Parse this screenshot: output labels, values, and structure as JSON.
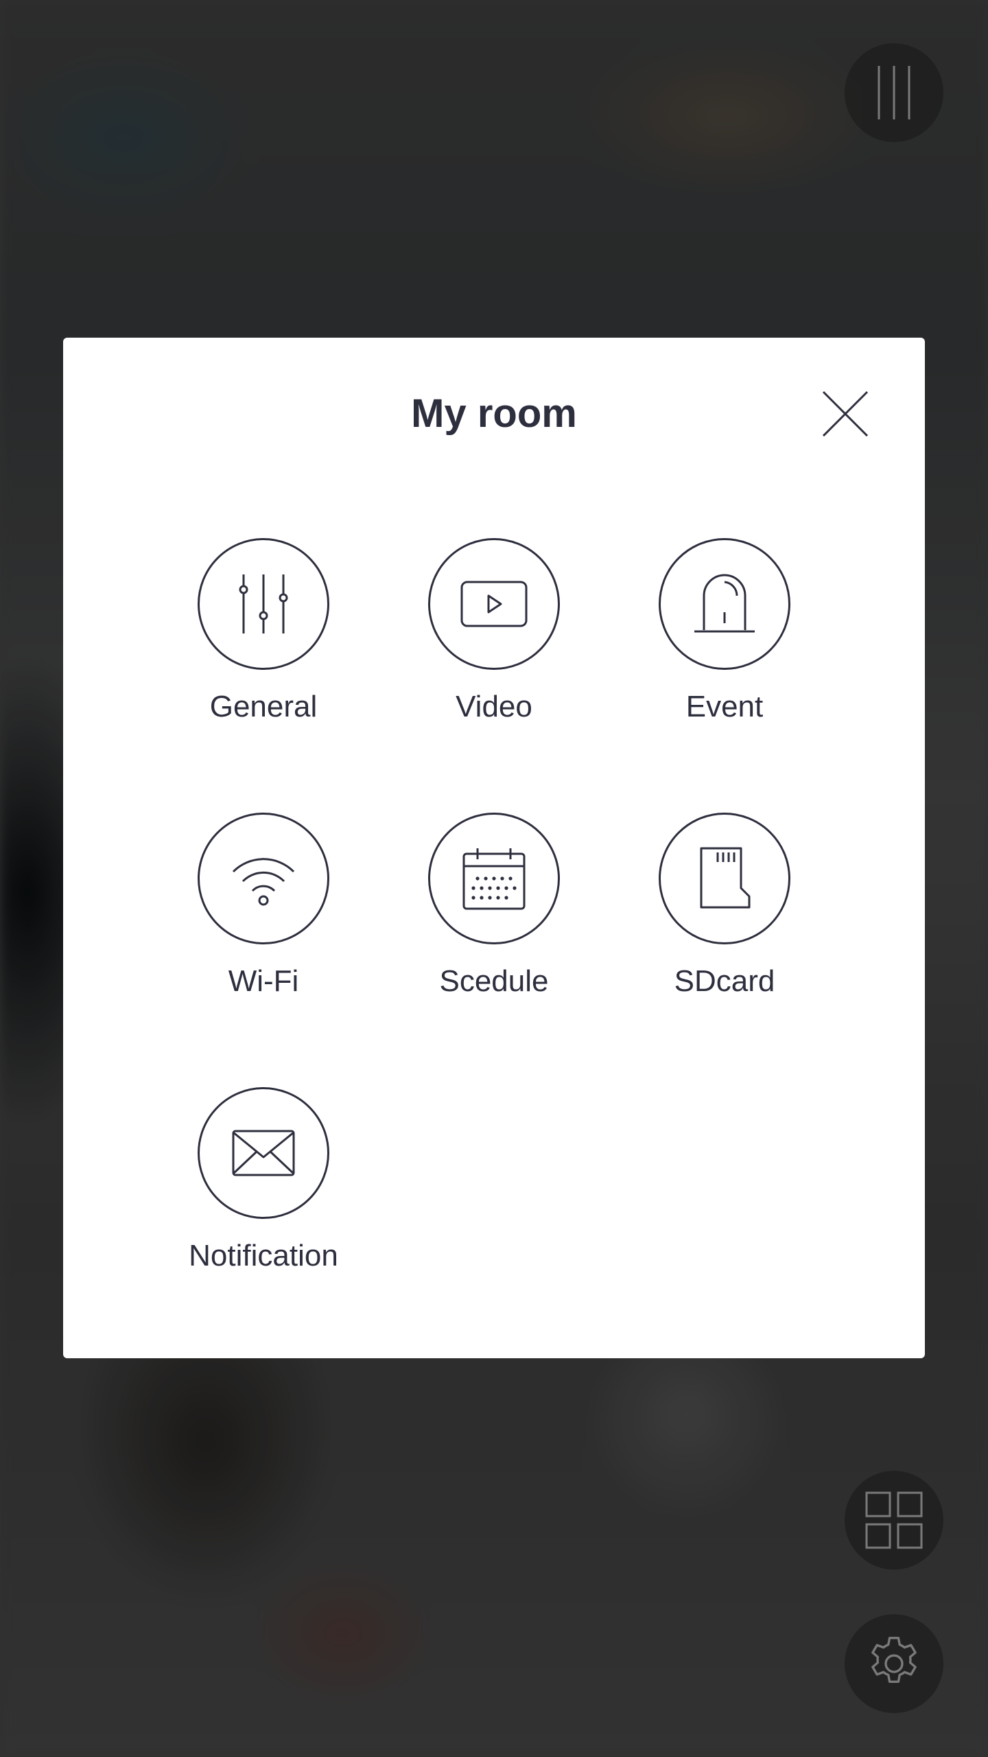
{
  "modal": {
    "title": "My room"
  },
  "menu": [
    {
      "label": "General",
      "icon": "sliders-icon"
    },
    {
      "label": "Video",
      "icon": "video-play-icon"
    },
    {
      "label": "Event",
      "icon": "siren-icon"
    },
    {
      "label": "Wi-Fi",
      "icon": "wifi-icon"
    },
    {
      "label": "Scedule",
      "icon": "calendar-icon"
    },
    {
      "label": "SDcard",
      "icon": "sd-card-icon"
    },
    {
      "label": "Notification",
      "icon": "envelope-icon"
    }
  ],
  "floating_buttons": {
    "menu": "menu-bars-icon",
    "grid": "grid-icon",
    "settings": "gear-icon"
  },
  "colors": {
    "ink": "#2e2f3e",
    "modal_bg": "#ffffff",
    "fab_bg": "#1e1e1e"
  }
}
